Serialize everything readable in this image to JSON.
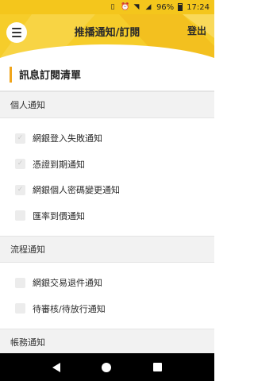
{
  "status_bar": {
    "battery": "96%",
    "time": "17:24"
  },
  "header": {
    "title": "推播通知/訂閱",
    "logout_label": "登出"
  },
  "section": {
    "title": "訊息訂閱清單"
  },
  "groups": [
    {
      "title": "個人通知",
      "items": [
        {
          "label": "網銀登入失敗通知",
          "checked": true
        },
        {
          "label": "憑證到期通知",
          "checked": true
        },
        {
          "label": "網銀個人密碼變更通知",
          "checked": true
        },
        {
          "label": "匯率到價通知",
          "checked": false
        }
      ]
    },
    {
      "title": "流程通知",
      "items": [
        {
          "label": "網銀交易退件通知",
          "checked": false
        },
        {
          "label": "待審核/待放行通知",
          "checked": false
        }
      ]
    },
    {
      "title": "帳務通知",
      "items": []
    }
  ],
  "colors": {
    "header": "#f6cd2a",
    "accent_bar": "#f0a51c"
  }
}
